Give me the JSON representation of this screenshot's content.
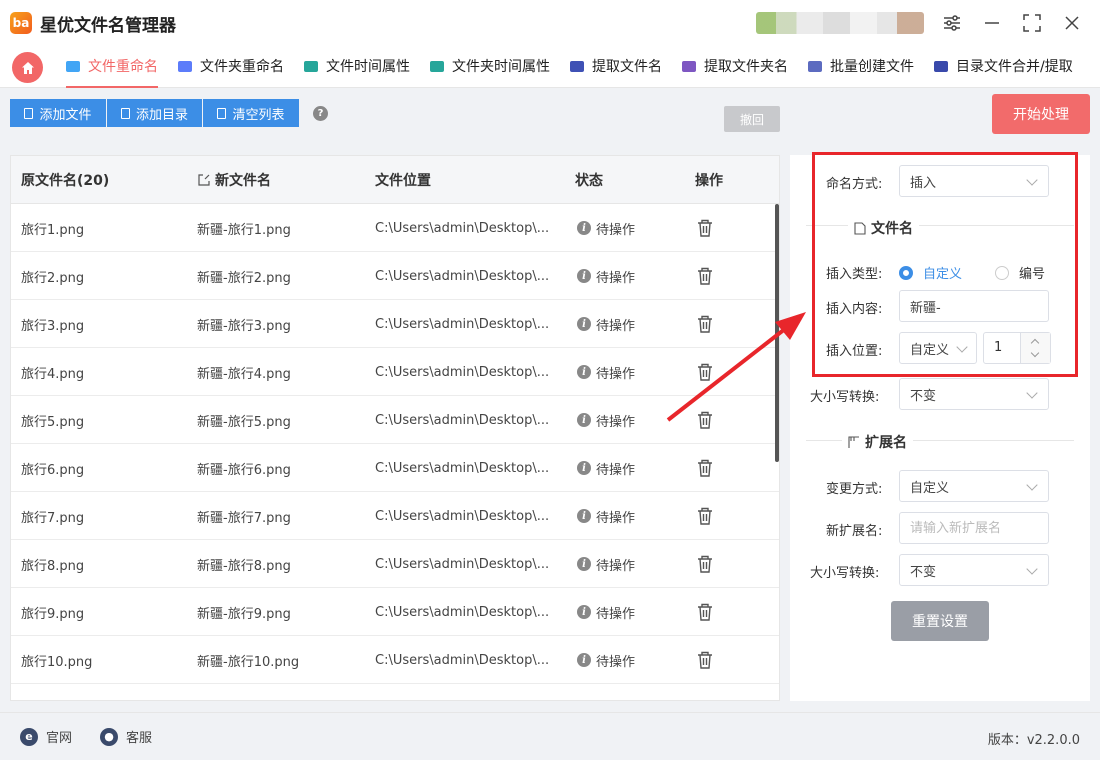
{
  "app": {
    "title": "星优文件名管理器",
    "logo_text": "ba"
  },
  "window": {
    "settings_icon": "sliders-icon",
    "minimize": "—",
    "maximize": "⛶",
    "close": "✕"
  },
  "tabs": [
    {
      "label": "文件重命名",
      "color": "#42a5f5"
    },
    {
      "label": "文件夹重命名",
      "color": "#5c7cfa"
    },
    {
      "label": "文件时间属性",
      "color": "#26a69a"
    },
    {
      "label": "文件夹时间属性",
      "color": "#26a69a"
    },
    {
      "label": "提取文件名",
      "color": "#3f51b5"
    },
    {
      "label": "提取文件夹名",
      "color": "#7e57c2"
    },
    {
      "label": "批量创建文件",
      "color": "#5c6bc0"
    },
    {
      "label": "目录文件合并/提取",
      "color": "#3949ab"
    }
  ],
  "toolbar": {
    "add_file": "添加文件",
    "add_dir": "添加目录",
    "clear_list": "清空列表",
    "help": "?",
    "undo": "撤回",
    "start": "开始处理"
  },
  "table": {
    "headers": {
      "orig": "原文件名(20)",
      "new": "新文件名",
      "location": "文件位置",
      "status": "状态",
      "action": "操作"
    },
    "rows": [
      {
        "orig": "旅行1.png",
        "new": "新疆-旅行1.png",
        "location": "C:\\Users\\admin\\Desktop\\...",
        "status": "待操作"
      },
      {
        "orig": "旅行2.png",
        "new": "新疆-旅行2.png",
        "location": "C:\\Users\\admin\\Desktop\\...",
        "status": "待操作"
      },
      {
        "orig": "旅行3.png",
        "new": "新疆-旅行3.png",
        "location": "C:\\Users\\admin\\Desktop\\...",
        "status": "待操作"
      },
      {
        "orig": "旅行4.png",
        "new": "新疆-旅行4.png",
        "location": "C:\\Users\\admin\\Desktop\\...",
        "status": "待操作"
      },
      {
        "orig": "旅行5.png",
        "new": "新疆-旅行5.png",
        "location": "C:\\Users\\admin\\Desktop\\...",
        "status": "待操作"
      },
      {
        "orig": "旅行6.png",
        "new": "新疆-旅行6.png",
        "location": "C:\\Users\\admin\\Desktop\\...",
        "status": "待操作"
      },
      {
        "orig": "旅行7.png",
        "new": "新疆-旅行7.png",
        "location": "C:\\Users\\admin\\Desktop\\...",
        "status": "待操作"
      },
      {
        "orig": "旅行8.png",
        "new": "新疆-旅行8.png",
        "location": "C:\\Users\\admin\\Desktop\\...",
        "status": "待操作"
      },
      {
        "orig": "旅行9.png",
        "new": "新疆-旅行9.png",
        "location": "C:\\Users\\admin\\Desktop\\...",
        "status": "待操作"
      },
      {
        "orig": "旅行10.png",
        "new": "新疆-旅行10.png",
        "location": "C:\\Users\\admin\\Desktop\\...",
        "status": "待操作"
      }
    ]
  },
  "settings": {
    "naming_mode_label": "命名方式:",
    "naming_mode_value": "插入",
    "filename_section": "文件名",
    "insert_type_label": "插入类型:",
    "insert_type_custom": "自定义",
    "insert_type_number": "编号",
    "insert_content_label": "插入内容:",
    "insert_content_value": "新疆-",
    "insert_pos_label": "插入位置:",
    "insert_pos_value": "自定义",
    "insert_pos_num": "1",
    "case_label": "大小写转换:",
    "case_value": "不变",
    "ext_section": "扩展名",
    "change_mode_label": "变更方式:",
    "change_mode_value": "自定义",
    "new_ext_label": "新扩展名:",
    "new_ext_placeholder": "请输入新扩展名",
    "ext_case_label": "大小写转换:",
    "ext_case_value": "不变",
    "reset": "重置设置"
  },
  "footer": {
    "website": "官网",
    "support": "客服",
    "version": "版本：v2.2.0.0"
  }
}
